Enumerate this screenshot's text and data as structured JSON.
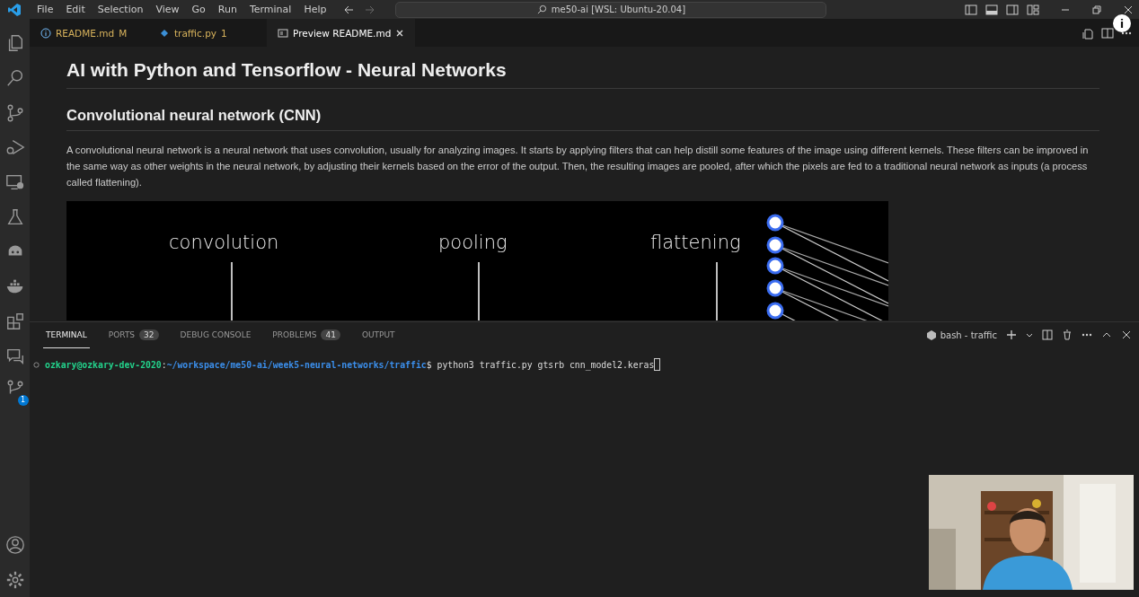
{
  "menu": [
    "File",
    "Edit",
    "Selection",
    "View",
    "Go",
    "Run",
    "Terminal",
    "Help"
  ],
  "command_center": {
    "value": "me50-ai [WSL: Ubuntu-20.04]"
  },
  "tabs": [
    {
      "label": "README.md",
      "badge": "M",
      "kind": "info",
      "selected": false
    },
    {
      "label": "traffic.py",
      "badge": "1",
      "kind": "python",
      "selected": false
    },
    {
      "label": "Preview README.md",
      "kind": "preview",
      "selected": true
    }
  ],
  "activity_bar": {
    "source_control_badge": "1"
  },
  "preview": {
    "title": "AI with Python and Tensorflow - Neural Networks",
    "heading": "Convolutional neural network (CNN)",
    "paragraph": "A convolutional neural network is a neural network that uses convolution, usually for analyzing images. It starts by applying filters that can help distill some features of the image using different kernels. These filters can be improved in the same way as other weights in the neural network, by adjusting their kernels based on the error of the output. Then, the resulting images are pooled, after which the pixels are fed to a traditional neural network as inputs (a process called flattening).",
    "diagram_labels": [
      "convolution",
      "pooling",
      "flattening"
    ]
  },
  "panel": {
    "tabs": [
      {
        "label": "TERMINAL",
        "selected": true
      },
      {
        "label": "PORTS",
        "count": "32",
        "selected": false
      },
      {
        "label": "DEBUG CONSOLE",
        "selected": false
      },
      {
        "label": "PROBLEMS",
        "count": "41",
        "selected": false
      },
      {
        "label": "OUTPUT",
        "selected": false
      }
    ],
    "terminal_name": "bash - traffic",
    "prompt_user": "ozkary@ozkary-dev-2020",
    "prompt_sep": ":",
    "prompt_path": "~/workspace/me50-ai/week5-neural-networks/traffic",
    "prompt_end": "$",
    "command": "python3 traffic.py gtsrb cnn_model2.keras"
  }
}
